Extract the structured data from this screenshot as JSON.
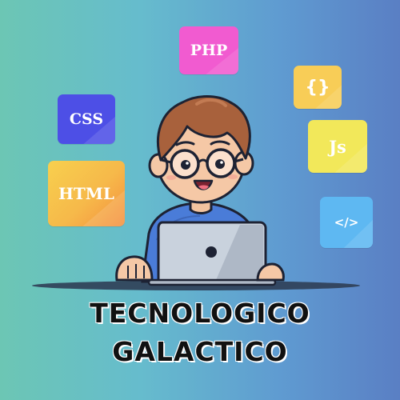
{
  "tiles": {
    "php": "PHP",
    "css": "CSS",
    "html": "HTML",
    "braces": "{}",
    "js": "Js",
    "code": "</>"
  },
  "title": {
    "line1": "TECNOLOGICO",
    "line2": "GALACTICO"
  },
  "colors": {
    "php": "#f15bd0",
    "css": "#4d4fe6",
    "html": "#f7c84b",
    "braces": "#f8cd57",
    "js": "#f2e85a",
    "code": "#5eb8f2",
    "shirt": "#4a7cd8",
    "hair": "#a8613c"
  }
}
